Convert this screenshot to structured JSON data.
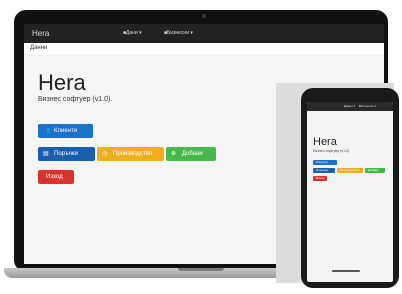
{
  "laptop": {
    "navbar": {
      "brand": "Hera",
      "menu_1": "■Дани ▾",
      "menu_2": "■Бизнесни ▾"
    },
    "subbar": {
      "label": "Данни"
    },
    "main": {
      "title": "Hera",
      "subtitle": "Бизнес софтуер (v1.0).",
      "buttons": {
        "clients": "Клиенти",
        "orders": "Поръчки",
        "processing": "Производство",
        "add": "Добави",
        "exit": "Изход"
      }
    }
  },
  "phone": {
    "title": "Hera",
    "subtitle": "Бизнес софтуер (v1.0).",
    "buttons": {
      "clients": "Клиенти",
      "orders": "Поръчки",
      "processing": "Производство",
      "add": "Добави",
      "exit": "Изход"
    }
  },
  "colors": {
    "primary": "#1a73c9",
    "warning": "#f0ad1d",
    "success": "#46b94a",
    "danger": "#d8332f",
    "navbar": "#222222"
  }
}
